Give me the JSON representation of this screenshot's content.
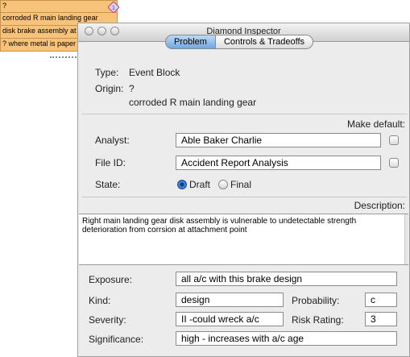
{
  "background_block": {
    "lines": [
      "?",
      "corroded R main landing gear",
      "disk brake assembly at ?",
      "? where metal is paper th"
    ],
    "diamond_number": "1"
  },
  "window": {
    "title": "Diamond Inspector",
    "tabs": [
      {
        "label": "Problem",
        "selected": true
      },
      {
        "label": "Controls & Tradeoffs",
        "selected": false
      }
    ]
  },
  "problem": {
    "type_label": "Type:",
    "type_value": "Event Block",
    "origin_label": "Origin:",
    "origin_value_line1": "?",
    "origin_value_line2": "corroded R main landing gear",
    "make_default_label": "Make default:",
    "analyst_label": "Analyst:",
    "analyst_value": "Able Baker Charlie",
    "file_id_label": "File ID:",
    "file_id_value": "Accident Report Analysis",
    "state_label": "State:",
    "state_options": [
      {
        "label": "Draft",
        "selected": true
      },
      {
        "label": "Final",
        "selected": false
      }
    ],
    "description_label": "Description:",
    "description_text": "Right main landing gear disk assembly is vulnerable to undetectable strength deterioration from corrsion at attachment point",
    "exposure_label": "Exposure:",
    "exposure_value": "all a/c with this brake design",
    "kind_label": "Kind:",
    "kind_value": "design",
    "probability_label": "Probability:",
    "probability_value": "c",
    "severity_label": "Severity:",
    "severity_value": "II -could wreck a/c",
    "risk_rating_label": "Risk Rating:",
    "risk_rating_value": "3",
    "significance_label": "Significance:",
    "significance_value": "high -  increases with a/c age"
  }
}
